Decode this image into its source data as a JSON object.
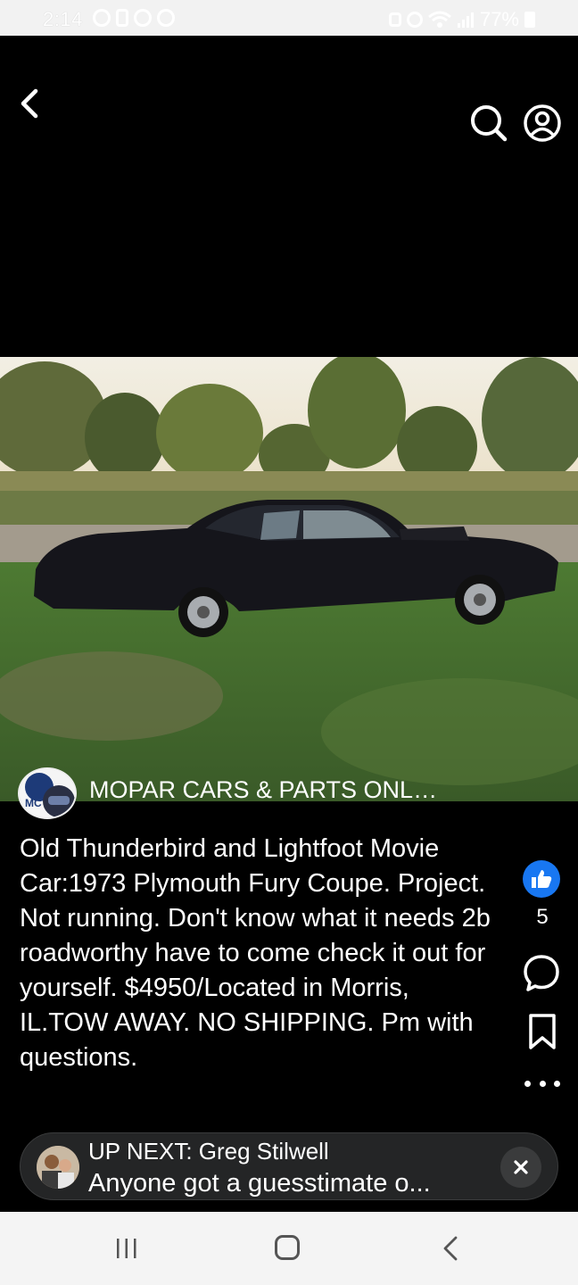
{
  "status_bar": {
    "time": "2:14",
    "battery": "77%"
  },
  "header": {
    "back_icon": "chevron-left-icon",
    "search_icon": "search-icon",
    "profile_icon": "account-circle-icon"
  },
  "post": {
    "group_name": "MOPAR CARS & PARTS ONL…",
    "caption": "Old Thunderbird and Lightfoot Movie Car:1973 Plymouth Fury Coupe. Project. Not running. Don't know what it needs 2b roadworthy have to come check it out for yourself. $4950/Located in Morris, IL.TOW AWAY. NO SHIPPING. Pm with questions.",
    "like_count": "5",
    "like_color": "#1877f2"
  },
  "up_next": {
    "label": "UP NEXT: Greg Stilwell",
    "title": "Anyone got a guesstimate o..."
  },
  "nav": {
    "recent_icon": "recent-apps-icon",
    "home_icon": "home-icon",
    "back_icon": "back-icon"
  }
}
